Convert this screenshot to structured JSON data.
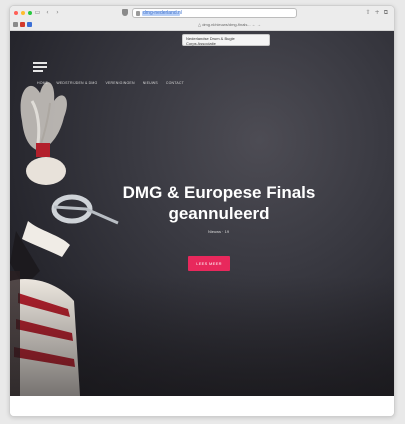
{
  "browser": {
    "url": "dmg-nederland.nl",
    "nav_back": "‹",
    "nav_forward": "›",
    "nav_sidebar": "▭",
    "right_icons": [
      "⇧",
      "+",
      "⧉"
    ],
    "tab_hint": "△ dmg.nl/nieuws/dmg-finals... ← →",
    "tooltip_lines": [
      "Nederlandse Drum & Bugle",
      "Corps Associatie"
    ],
    "icons": {
      "shield": "shield-icon",
      "lock": "lock-icon"
    }
  },
  "site": {
    "menu": [
      "Home",
      "Wedstrijden & DMG",
      "Verenigingen",
      "Nieuws",
      "Contact"
    ],
    "headline_line1": "DMG & Europese Finals",
    "headline_line2": "geannuleerd",
    "subline": "Nieuws · 19",
    "cta_label": "Lees meer",
    "accent_color": "#e8285c"
  }
}
